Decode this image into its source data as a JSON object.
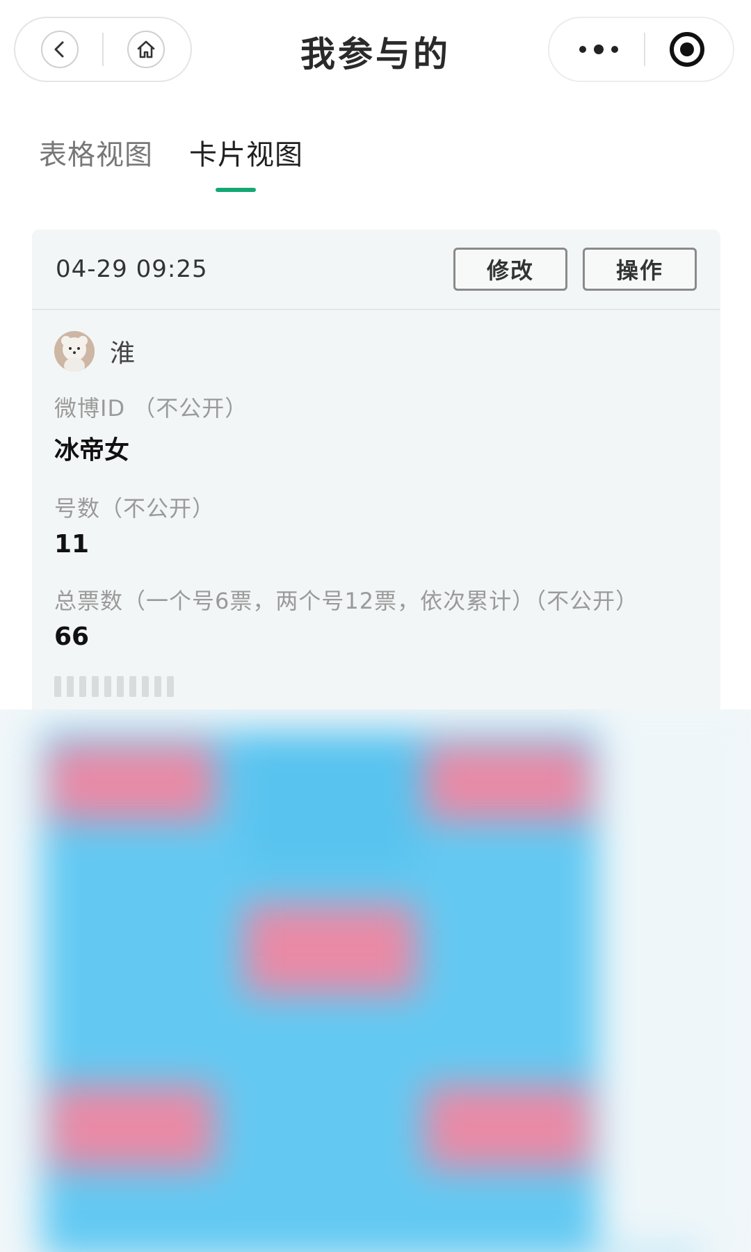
{
  "nav": {
    "title": "我参与的",
    "back_icon": "chevron-left-icon",
    "home_icon": "home-icon",
    "more_icon": "more-dots-icon",
    "target_icon": "target-icon"
  },
  "tabs": [
    {
      "label": "表格视图",
      "active": false
    },
    {
      "label": "卡片视图",
      "active": true
    }
  ],
  "card": {
    "time": "04-29 09:25",
    "edit_label": "修改",
    "action_label": "操作",
    "user_name": "淮",
    "fields": [
      {
        "label": "微博ID （不公开）",
        "value": "冰帝女"
      },
      {
        "label": "号数（不公开）",
        "value": "11"
      },
      {
        "label": "总票数（一个号6票，两个号12票，依次累计）（不公开）",
        "value": "66"
      }
    ]
  },
  "colors": {
    "accent": "#14a873",
    "blur_blue": "#5fc8f0",
    "blur_pink": "#e98aa6"
  }
}
